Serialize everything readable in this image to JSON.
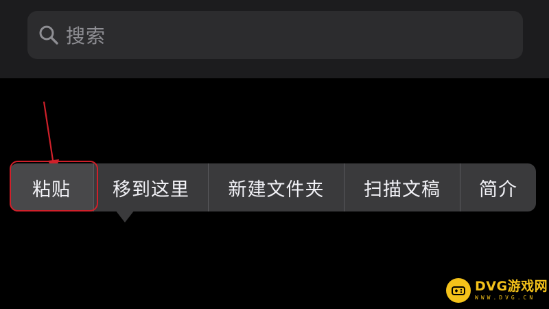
{
  "search": {
    "placeholder": "搜索",
    "icon": "search-icon"
  },
  "context_menu": {
    "items": [
      {
        "label": "粘贴"
      },
      {
        "label": "移到这里"
      },
      {
        "label": "新建文件夹"
      },
      {
        "label": "扫描文稿"
      },
      {
        "label": "简介"
      }
    ]
  },
  "annotation": {
    "highlight_color": "#d0202a",
    "arrow_icon": "red-arrow-icon"
  },
  "watermark": {
    "title": "DVG游戏网",
    "subtitle": "WWW.DVG.CN",
    "color": "#f4c21a",
    "icon": "gamepad-icon"
  }
}
